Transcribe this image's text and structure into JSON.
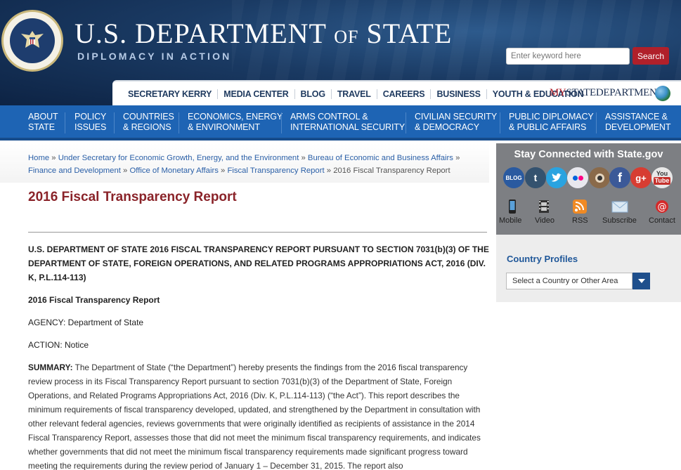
{
  "header": {
    "title_part1": "U.S. DEPARTMENT",
    "title_of": "OF",
    "title_part2": "STATE",
    "subtitle": "DIPLOMACY IN ACTION",
    "search_placeholder": "Enter keyword here",
    "search_button": "Search"
  },
  "top_nav": {
    "items": [
      "SECRETARY KERRY",
      "MEDIA CENTER",
      "BLOG",
      "TRAVEL",
      "CAREERS",
      "BUSINESS",
      "YOUTH & EDUCATION"
    ],
    "mystate_my": "MY",
    "mystate_rest": "STATEDEPARTMENT"
  },
  "main_nav": [
    {
      "line1": "ABOUT",
      "line2": "STATE"
    },
    {
      "line1": "POLICY",
      "line2": "ISSUES"
    },
    {
      "line1": "COUNTRIES",
      "line2": "& REGIONS"
    },
    {
      "line1": "ECONOMICS, ENERGY",
      "line2": "& ENVIRONMENT"
    },
    {
      "line1": "ARMS CONTROL &",
      "line2": "INTERNATIONAL SECURITY"
    },
    {
      "line1": "CIVILIAN SECURITY",
      "line2": "& DEMOCRACY"
    },
    {
      "line1": "PUBLIC DIPLOMACY",
      "line2": "& PUBLIC AFFAIRS"
    },
    {
      "line1": "ASSISTANCE &",
      "line2": "DEVELOPMENT"
    }
  ],
  "breadcrumb": {
    "items": [
      "Home",
      "Under Secretary for Economic Growth, Energy, and the Environment",
      "Bureau of Economic and Business Affairs",
      "Finance and Development",
      "Office of Monetary Affairs",
      "Fiscal Transparency Report"
    ],
    "current": "2016 Fiscal Transparency Report",
    "separator": "»"
  },
  "content": {
    "page_title": "2016 Fiscal Transparency Report",
    "heading": "U.S. DEPARTMENT OF STATE 2016 FISCAL TRANSPARENCY REPORT PURSUANT TO SECTION 7031(b)(3) OF THE DEPARTMENT OF STATE, FOREIGN OPERATIONS, AND RELATED PROGRAMS APPROPRIATIONS ACT, 2016 (DIV. K, P.L.114-113)",
    "subheading": "2016 Fiscal Transparency Report",
    "agency": "AGENCY: Department of State",
    "action": "ACTION: Notice",
    "summary_label": "SUMMARY:",
    "summary_text": " The Department of State (“the Department”) hereby presents the findings from the 2016 fiscal transparency review process in its Fiscal Transparency Report pursuant to section 7031(b)(3) of the Department of State, Foreign Operations, and Related Programs Appropriations Act, 2016 (Div. K, P.L.114-113) (“the Act”). This report describes the minimum requirements of fiscal transparency developed, updated, and strengthened by the Department in consultation with other relevant federal agencies, reviews governments that were originally identified as recipients of assistance in the 2014 Fiscal Transparency Report, assesses those that did not meet the minimum fiscal transparency requirements, and indicates whether governments that did not meet the minimum fiscal transparency requirements made significant progress toward meeting the requirements during the review period of January 1 – December 31, 2015. The report also"
  },
  "sidebar": {
    "stay_connected": "Stay Connected with State.gov",
    "social": [
      {
        "icon": "blog-icon",
        "glyph": "BLOG",
        "color": "#2a5aa0"
      },
      {
        "icon": "tumblr-icon",
        "glyph": "t",
        "color": "#34526f"
      },
      {
        "icon": "twitter-icon",
        "glyph": "🐦",
        "color": "#2aa3e0"
      },
      {
        "icon": "flickr-icon",
        "glyph": "●●",
        "color": "#e8e8ee"
      },
      {
        "icon": "instagram-icon",
        "glyph": "◉",
        "color": "#8a6a4a"
      },
      {
        "icon": "facebook-icon",
        "glyph": "f",
        "color": "#3b5998"
      },
      {
        "icon": "googleplus-icon",
        "glyph": "g+",
        "color": "#d73d32"
      },
      {
        "icon": "youtube-icon",
        "glyph": "You",
        "color": "#e8e8e8"
      }
    ],
    "follow": [
      "Mobile",
      "Video",
      "RSS",
      "Subscribe",
      "Contact"
    ],
    "country_profiles_title": "Country Profiles",
    "country_select": "Select a Country or Other Area"
  }
}
